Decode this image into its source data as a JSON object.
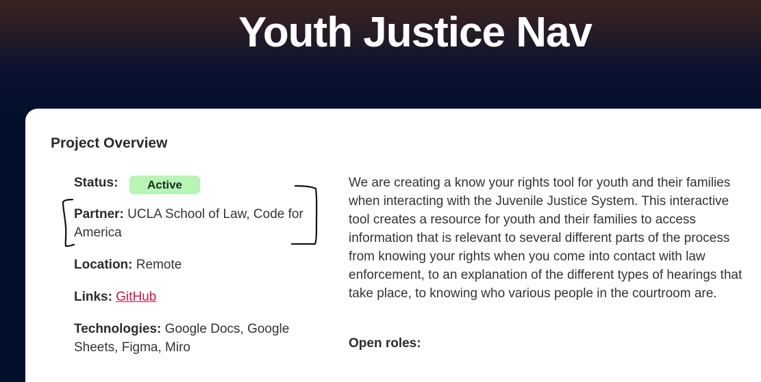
{
  "header": {
    "title": "Youth Justice Nav"
  },
  "overview": {
    "heading": "Project Overview",
    "status_label": "Status:",
    "status_value": "Active",
    "partner_label": "Partner:",
    "partner_value": "UCLA School of Law, Code for America",
    "location_label": "Location:",
    "location_value": "Remote",
    "links_label": "Links:",
    "links_value": "GitHub",
    "technologies_label": "Technologies:",
    "technologies_value": "Google Docs, Google Sheets, Figma, Miro"
  },
  "description": {
    "text": "We are creating a know your rights tool for youth and their families when interacting with the Juvenile Justice System. This interactive tool creates a resource for youth and their families to access information that is relevant to several different parts of the process from knowing your rights when you come into contact with law enforcement, to an explanation of the different types of hearings that take place, to knowing who various people in the courtroom are.",
    "open_roles_label": "Open roles:"
  },
  "colors": {
    "status_badge": "#b5f6b5",
    "link": "#c7144a",
    "hero_dark": "#03102c",
    "hero_top": "#3a2320"
  }
}
